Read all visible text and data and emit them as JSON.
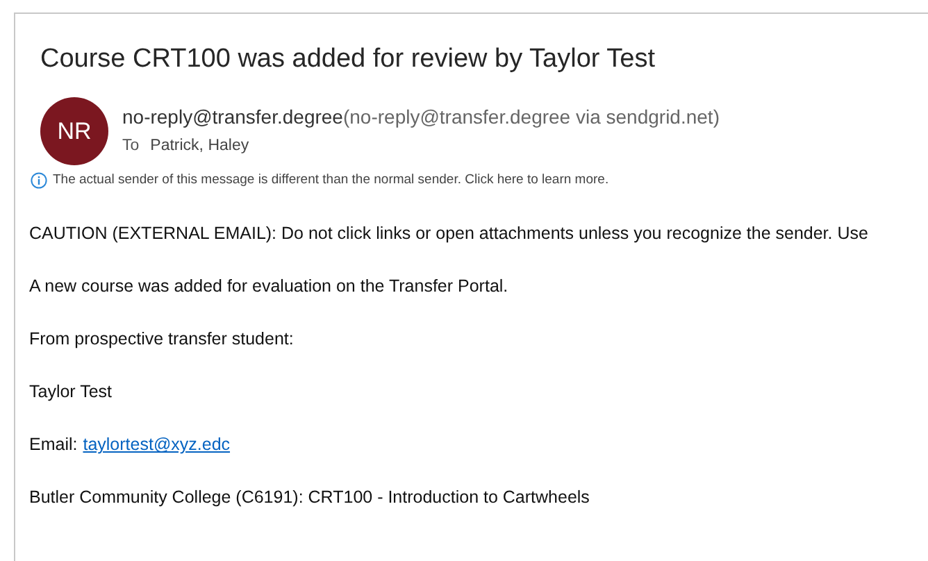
{
  "email": {
    "subject": "Course CRT100 was added for review by Taylor Test",
    "avatar": "NR",
    "sender": "no-reply@transfer.degree",
    "sender_detail": "(no-reply@transfer.degree via sendgrid.net)",
    "to_label": "To",
    "recipients": "Patrick, Haley",
    "notice": "The actual sender of this message is different than the normal sender. Click here to learn more.",
    "body": [
      {
        "kind": "text",
        "text": "CAUTION (EXTERNAL EMAIL): Do not click links or open attachments unless you recognize the sender. Use"
      },
      {
        "kind": "text",
        "text": "A new course was added for evaluation on the Transfer Portal."
      },
      {
        "kind": "text",
        "text": "From prospective transfer student:"
      },
      {
        "kind": "text",
        "text": "Taylor Test"
      },
      {
        "kind": "email",
        "label": "Email:",
        "link": "taylortest@xyz.edc"
      },
      {
        "kind": "text",
        "text": "Butler Community College (C6191): CRT100 - Introduction to Cartwheels"
      }
    ]
  }
}
